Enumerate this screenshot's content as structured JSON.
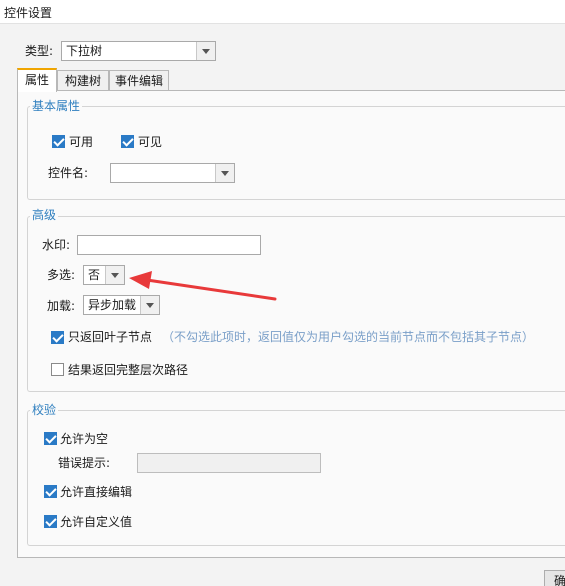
{
  "window": {
    "title": "控件设置"
  },
  "type_row": {
    "label": "类型:",
    "value": "下拉树"
  },
  "tabs": [
    {
      "label": "属性",
      "active": true
    },
    {
      "label": "构建树",
      "active": false
    },
    {
      "label": "事件编辑",
      "active": false
    }
  ],
  "basic": {
    "title": "基本属性",
    "enabled": {
      "label": "可用",
      "checked": true
    },
    "visible": {
      "label": "可见",
      "checked": true
    },
    "widget_name": {
      "label": "控件名:",
      "value": ""
    }
  },
  "advanced": {
    "title": "高级",
    "watermark": {
      "label": "水印:",
      "value": ""
    },
    "multi_select": {
      "label": "多选:",
      "value": "否"
    },
    "loading": {
      "label": "加载:",
      "value": "异步加载"
    },
    "leaf_only": {
      "label": "只返回叶子节点",
      "checked": true,
      "hint": "（不勾选此项时，返回值仅为用户勾选的当前节点而不包括其子节点）"
    },
    "full_path": {
      "label": "结果返回完整层次路径",
      "checked": false
    }
  },
  "validation": {
    "title": "校验",
    "allow_empty": {
      "label": "允许为空",
      "checked": true
    },
    "error_hint": {
      "label": "错误提示:",
      "value": ""
    },
    "allow_direct_edit": {
      "label": "允许直接编辑",
      "checked": true
    },
    "allow_custom_value": {
      "label": "允许自定义值",
      "checked": true
    }
  },
  "footer": {
    "ok_label": "确"
  },
  "colors": {
    "accent": "#2f7fbf",
    "checkbox": "#2a7ac6",
    "active_tab": "#f0a500",
    "annotation_arrow": "#e8393a"
  }
}
